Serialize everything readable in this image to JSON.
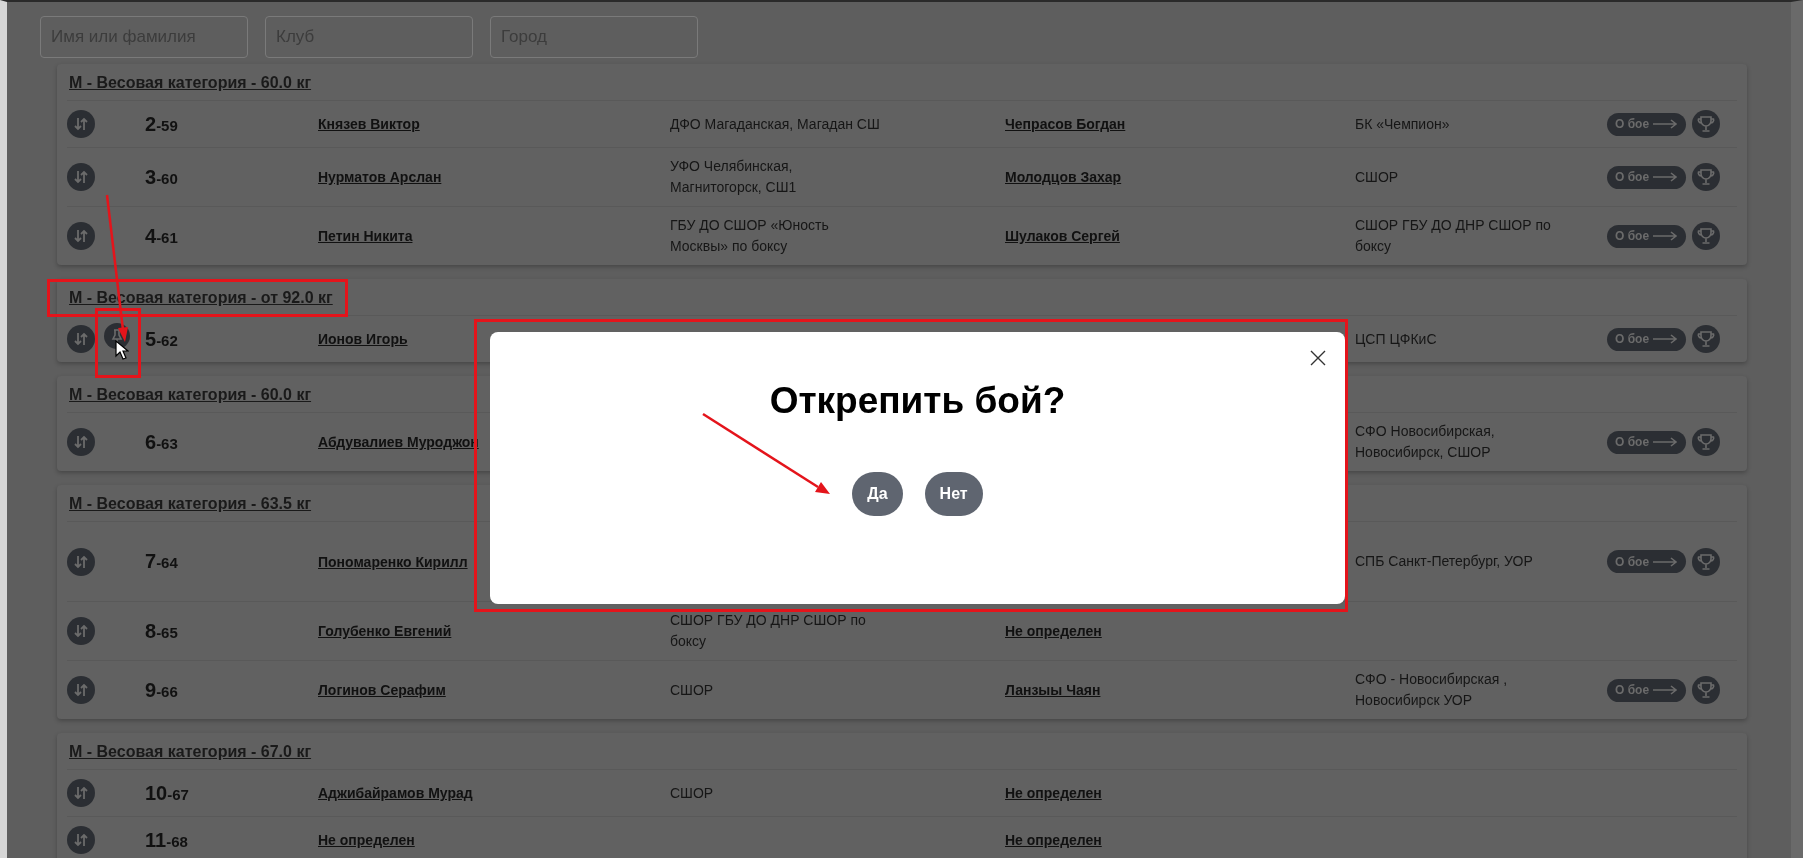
{
  "filters": [
    {
      "placeholder": "Имя или фамилия"
    },
    {
      "placeholder": "Клуб"
    },
    {
      "placeholder": "Город"
    }
  ],
  "groups": [
    {
      "title": "М - Весовая категория - 60.0 кг",
      "annotated": false,
      "bouts": [
        {
          "number": "2",
          "index": "-59",
          "fighter": "Князев Виктор",
          "fighter_club": "ДФО Магаданская, Магадан СШ",
          "opponent": "Чепрасов Богдан",
          "opponent_club": "БК «Чемпион»",
          "details_button": "О бое",
          "pinned": false
        },
        {
          "number": "3",
          "index": "-60",
          "fighter": "Нурматов Арслан",
          "fighter_club": "УФО Челябинская, Магнитогорск, СШ1",
          "opponent": "Молодцов Захар",
          "opponent_club": "СШОР",
          "details_button": "О бое",
          "pinned": false
        },
        {
          "number": "4",
          "index": "-61",
          "fighter": "Петин Никита",
          "fighter_club": "ГБУ ДО СШОР «Юность Москвы» по боксу",
          "opponent": "Шулаков Сергей",
          "opponent_club": "СШОР ГБУ ДО ДНР СШОР по боксу",
          "details_button": "О бое",
          "pinned": false
        }
      ]
    },
    {
      "title": "М - Весовая категория - от 92.0 кг",
      "annotated": true,
      "bouts": [
        {
          "number": "5",
          "index": "-62",
          "fighter": "Ионов Игорь",
          "opponent_club": "ЦСП ЦФКиС",
          "details_button": "О бое",
          "pinned": true,
          "pin_annotated": true
        }
      ]
    },
    {
      "title": "М - Весовая категория - 60.0 кг",
      "annotated": false,
      "bouts": [
        {
          "number": "6",
          "index": "-63",
          "fighter": "Абдувалиев Муроджон",
          "opponent_club": "СФО Новосибирская, Новосибирск, СШОР",
          "details_button": "О бое",
          "pinned": false
        }
      ]
    },
    {
      "title": "М - Весовая категория - 63.5 кг",
      "annotated": false,
      "bouts": [
        {
          "number": "7",
          "index": "-64",
          "fighter": "Пономаренко Кирилл",
          "opponent_club": "СПБ Санкт-Петербург, УОР",
          "details_button": "О бое",
          "pinned": false
        },
        {
          "number": "8",
          "index": "-65",
          "fighter": "Голубенко Евгений",
          "fighter_club": "СШОР ГБУ ДО ДНР СШОР по боксу",
          "opponent": "Не определен",
          "pinned": false
        },
        {
          "number": "9",
          "index": "-66",
          "fighter": "Логинов Серафим",
          "fighter_club": "СШОР",
          "opponent": "Ланзыы Чаян",
          "opponent_club": "СФО - Новосибирская , Новосибирск УОР",
          "details_button": "О бое",
          "pinned": false
        }
      ]
    },
    {
      "title": "М - Весовая категория - 67.0 кг",
      "annotated": false,
      "bouts": [
        {
          "number": "10",
          "index": "-67",
          "fighter": "Аджибайрамов Мурад",
          "fighter_club": "СШОР",
          "opponent": "Не определен",
          "pinned": false
        },
        {
          "number": "11",
          "index": "-68",
          "fighter": "Не определен",
          "opponent": "Не определен",
          "pinned": false
        }
      ]
    }
  ],
  "dialog": {
    "title": "Открепить бой?",
    "annotated": true,
    "buttons": [
      {
        "label": "Да"
      },
      {
        "label": "Нет"
      }
    ]
  }
}
